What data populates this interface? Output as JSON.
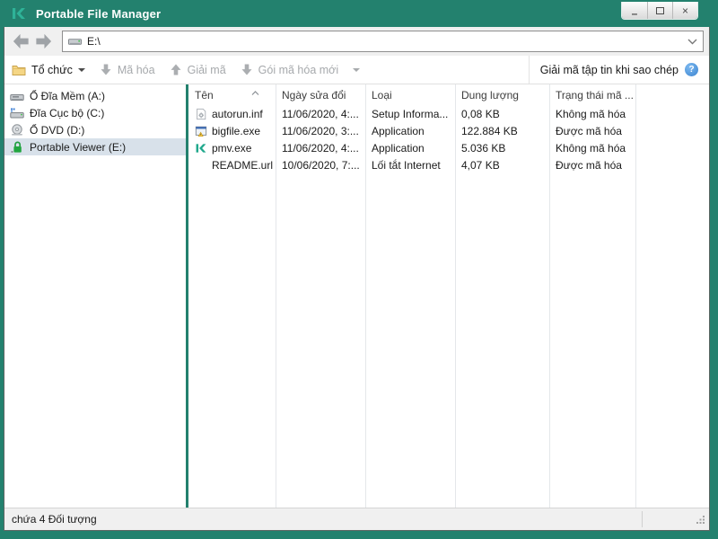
{
  "window": {
    "title": "Portable File Manager",
    "minimize_glyph": "–",
    "close_glyph": "×"
  },
  "navbar": {
    "address": "E:\\"
  },
  "toolbar": {
    "organize_label": "Tổ chức",
    "encrypt_label": "Mã hóa",
    "decrypt_label": "Giải mã",
    "new_package_label": "Gói mã hóa mới",
    "decrypt_on_copy_label": "Giải mã tập tin khi sao chép",
    "help_glyph": "?"
  },
  "sidebar": {
    "items": [
      {
        "label": "Ổ Đĩa Mềm (A:)",
        "icon": "floppy-drive-icon",
        "selected": false
      },
      {
        "label": "Đĩa Cục bộ (C:)",
        "icon": "local-disk-icon",
        "selected": false
      },
      {
        "label": "Ổ DVD (D:)",
        "icon": "dvd-drive-icon",
        "selected": false
      },
      {
        "label": "Portable Viewer (E:)",
        "icon": "lock-drive-icon",
        "selected": true
      }
    ]
  },
  "filelist": {
    "columns": [
      "Tên",
      "Ngày sửa đổi",
      "Loại",
      "Dung lượng",
      "Trạng thái mã ..."
    ],
    "sort_column": "Tên",
    "sort_direction": "ascending",
    "files": [
      {
        "name": "autorun.inf",
        "modified": "11/06/2020, 4:...",
        "type": "Setup Informa...",
        "size": "0,08 KB",
        "status": "Không mã hóa",
        "icon": "setup-information-file-icon"
      },
      {
        "name": "bigfile.exe",
        "modified": "11/06/2020, 3:...",
        "type": "Application",
        "size": "122.884 KB",
        "status": "Được mã hóa",
        "icon": "application-file-icon"
      },
      {
        "name": "pmv.exe",
        "modified": "11/06/2020, 4:...",
        "type": "Application",
        "size": "5.036 KB",
        "status": "Không mã hóa",
        "icon": "kaspersky-file-icon"
      },
      {
        "name": "README.url",
        "modified": "10/06/2020, 7:...",
        "type": "Lối tắt Internet",
        "size": "4,07 KB",
        "status": "Được mã hóa",
        "icon": "none"
      }
    ]
  },
  "statusbar": {
    "text": "chứa 4 Đối tượng"
  },
  "colors": {
    "titlebar": "#23816E",
    "divider": "#23816E",
    "selection": "#D8E1EA",
    "help": "#3C84D0"
  }
}
